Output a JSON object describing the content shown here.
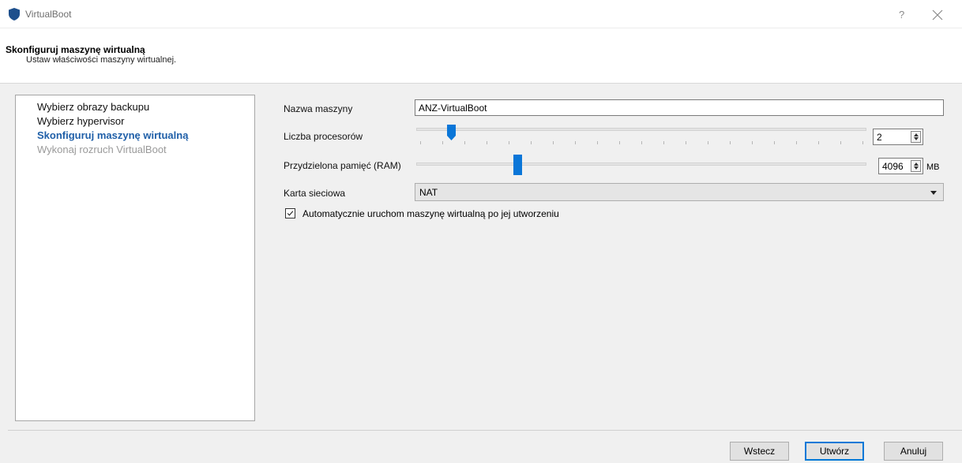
{
  "window": {
    "title": "VirtualBoot",
    "help_label": "?"
  },
  "header": {
    "title": "Skonfiguruj maszynę wirtualną",
    "subtitle": "Ustaw właściwości maszyny wirtualnej."
  },
  "steps": [
    {
      "label": "Wybierz obrazy backupu",
      "state": "done"
    },
    {
      "label": "Wybierz hypervisor",
      "state": "done"
    },
    {
      "label": "Skonfiguruj maszynę wirtualną",
      "state": "current"
    },
    {
      "label": "Wykonaj rozruch VirtualBoot",
      "state": "pending"
    }
  ],
  "form": {
    "name_label": "Nazwa maszyny",
    "name_value": "ANZ-VirtualBoot",
    "cpu_label": "Liczba procesorów",
    "cpu_value": "2",
    "cpu_slider_fraction": 0.07,
    "ram_label": "Przydzielona pamięć (RAM)",
    "ram_value": "4096",
    "ram_unit": "MB",
    "ram_slider_fraction": 0.22,
    "nic_label": "Karta sieciowa",
    "nic_value": "NAT",
    "autostart_label": "Automatycznie uruchom maszynę wirtualną po jej utworzeniu",
    "autostart_checked": true
  },
  "footer": {
    "back_label": "Wstecz",
    "create_label": "Utwórz",
    "cancel_label": "Anuluj"
  },
  "colors": {
    "accent": "#0a76d8",
    "current_step": "#1f5fa8",
    "pending_step": "#9a9a9a"
  }
}
